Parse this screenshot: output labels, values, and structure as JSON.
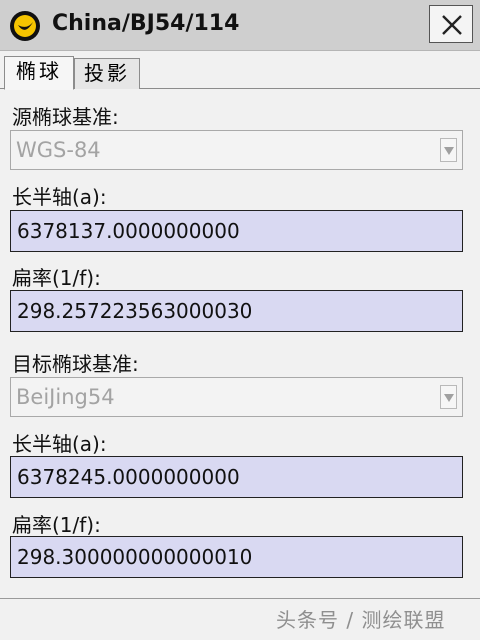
{
  "window": {
    "title": "China/BJ54/114",
    "close_glyph": "×"
  },
  "tabs": [
    {
      "label": "椭球",
      "active": true
    },
    {
      "label": "投影",
      "active": false
    }
  ],
  "source": {
    "datum_label": "源椭球基准:",
    "datum_value": "WGS-84",
    "semi_major_label": "长半轴(a):",
    "semi_major_value": "6378137.0000000000",
    "flattening_label": "扁率(1/f):",
    "flattening_value": "298.257223563000030"
  },
  "target": {
    "datum_label": "目标椭球基准:",
    "datum_value": "BeiJing54",
    "semi_major_label": "长半轴(a):",
    "semi_major_value": "6378245.0000000000",
    "flattening_label": "扁率(1/f):",
    "flattening_value": "298.300000000000010"
  },
  "watermark": "头条号 / 测绘联盟",
  "colors": {
    "field_bg": "#d9d9f2",
    "titlebar_bg": "#cfcfcf",
    "icon_yellow": "#f5c400"
  },
  "icons": [
    "app-icon",
    "close-icon",
    "dropdown-arrow-icon"
  ]
}
